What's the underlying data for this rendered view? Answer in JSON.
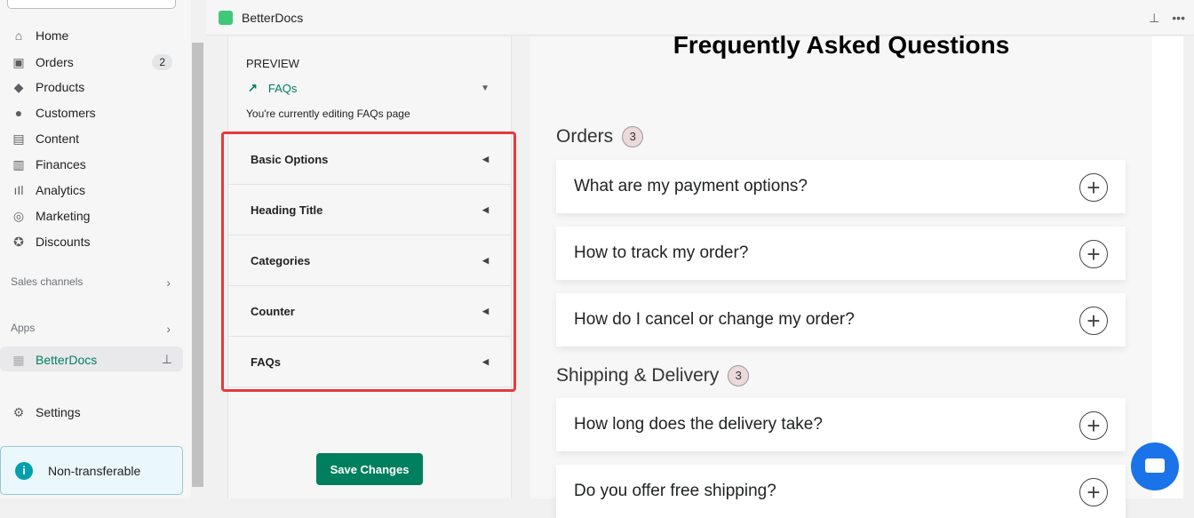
{
  "sidebar": {
    "items": [
      {
        "label": "Home",
        "icon": "home-icon"
      },
      {
        "label": "Orders",
        "icon": "orders-icon",
        "badge": "2"
      },
      {
        "label": "Products",
        "icon": "tag-icon"
      },
      {
        "label": "Customers",
        "icon": "person-icon"
      },
      {
        "label": "Content",
        "icon": "content-icon"
      },
      {
        "label": "Finances",
        "icon": "bank-icon"
      },
      {
        "label": "Analytics",
        "icon": "bar-chart-icon"
      },
      {
        "label": "Marketing",
        "icon": "marketing-icon"
      },
      {
        "label": "Discounts",
        "icon": "discount-icon"
      }
    ],
    "sales_channels": "Sales channels",
    "apps": "Apps",
    "app_active": "BetterDocs",
    "settings": "Settings",
    "notice": "Non-transferable"
  },
  "topbar": {
    "title": "BetterDocs"
  },
  "panel": {
    "preview_label": "PREVIEW",
    "preview_page": "FAQs",
    "editing_text": "You're currently editing FAQs page",
    "sections": [
      "Basic Options",
      "Heading Title",
      "Categories",
      "Counter",
      "FAQs"
    ],
    "save": "Save Changes"
  },
  "preview": {
    "title": "Frequently Asked Questions",
    "categories": [
      {
        "name": "Orders",
        "count": "3",
        "questions": [
          "What are my payment options?",
          "How to track my order?",
          "How do I cancel or change my order?"
        ]
      },
      {
        "name": "Shipping & Delivery",
        "count": "3",
        "questions": [
          "How long does the delivery take?",
          "Do you offer free shipping?"
        ]
      }
    ]
  },
  "colors": {
    "accent": "#007f5f",
    "highlight": "#e5393f",
    "chat": "#1a73e8"
  }
}
